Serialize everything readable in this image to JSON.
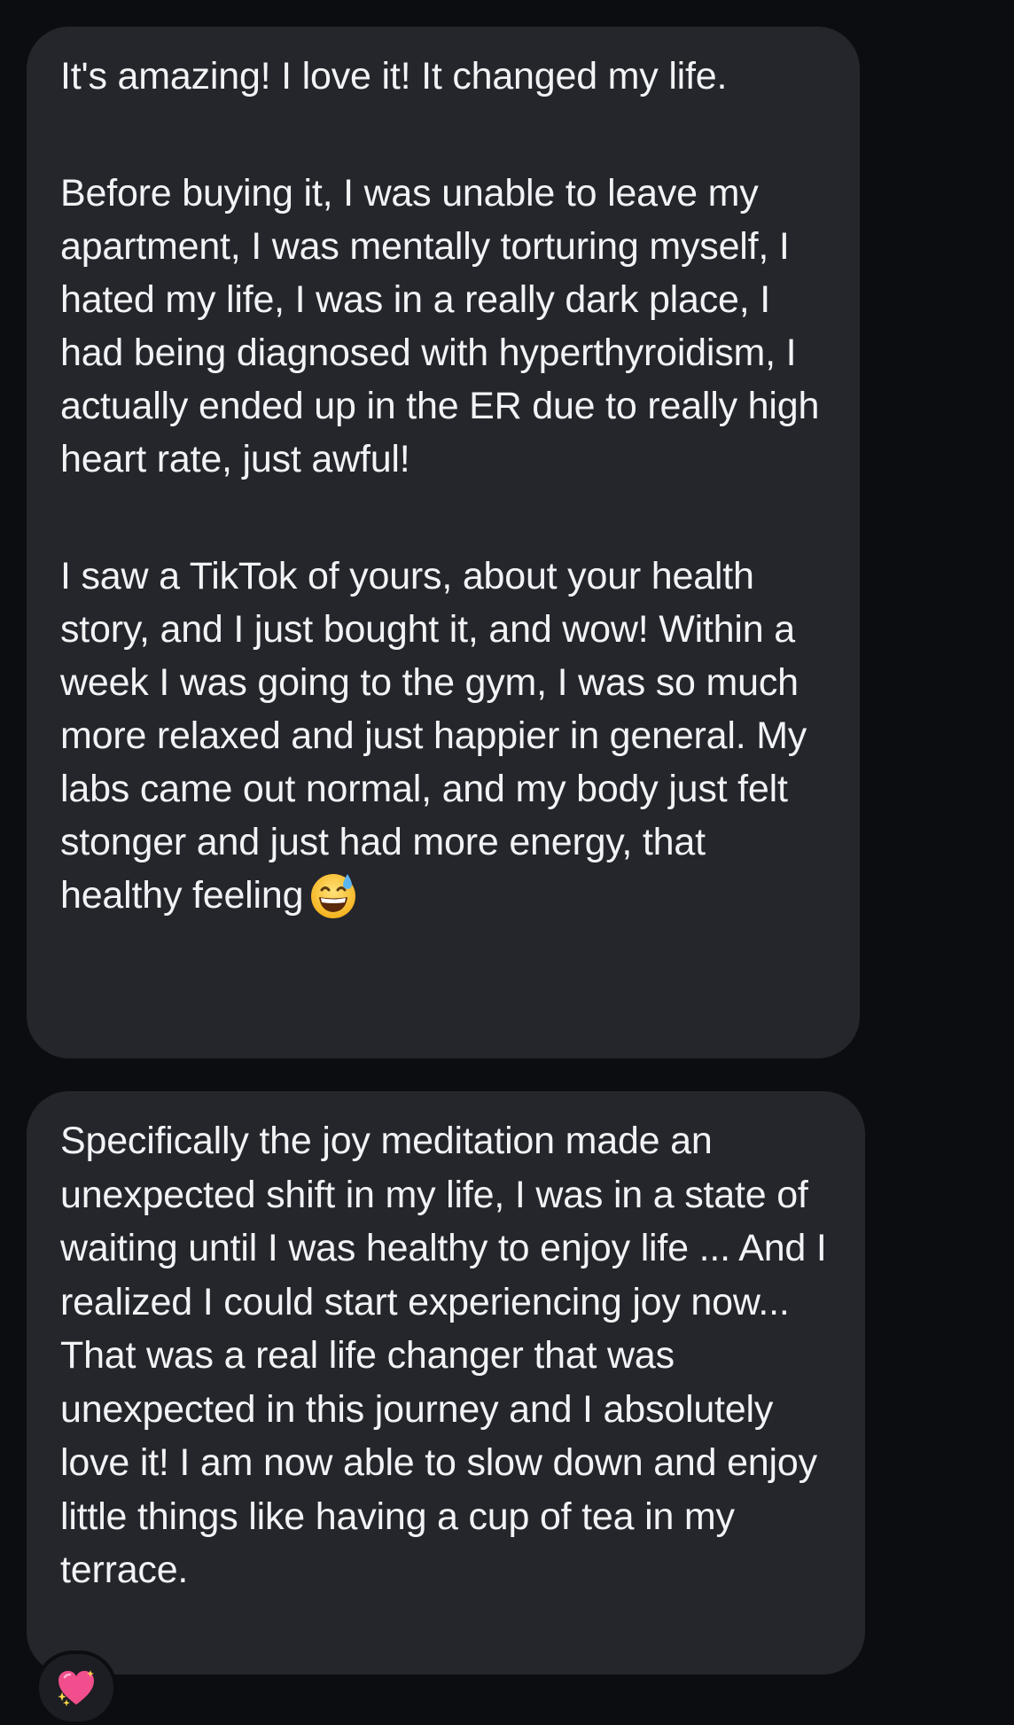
{
  "messages": [
    {
      "paragraphs": [
        "It's amazing! I love it! It changed my life.",
        "Before buying it, I was unable to leave my apartment, I was mentally torturing myself, I hated my life, I was in a really dark place, I had being diagnosed with hyperthyroidism, I actually ended up in the ER due to really high heart rate, just awful!",
        "I saw a TikTok of yours, about your health story, and I just bought it, and wow! Within a week I was going to the gym, I was so much more relaxed and just happier in general. My labs came out normal, and my body just felt stonger and just had more energy, that healthy feeling"
      ],
      "trailing_emoji": "grinning-face-with-sweat-icon"
    },
    {
      "paragraphs": [
        "Specifically the joy meditation made an unexpected shift in my life, I was in a state of waiting until I was healthy to enjoy life ... And I realized I could start experiencing joy now... That was a real life changer that was unexpected in this journey and I absolutely love it! I am now able to slow down and enjoy little things like having a cup of tea in my terrace."
      ],
      "reaction": "sparkling-heart-icon"
    }
  ],
  "colors": {
    "background": "#0b0d10",
    "bubble": "#24262c",
    "text": "#f2f3f5",
    "reaction_heart": "#f04e8c"
  }
}
